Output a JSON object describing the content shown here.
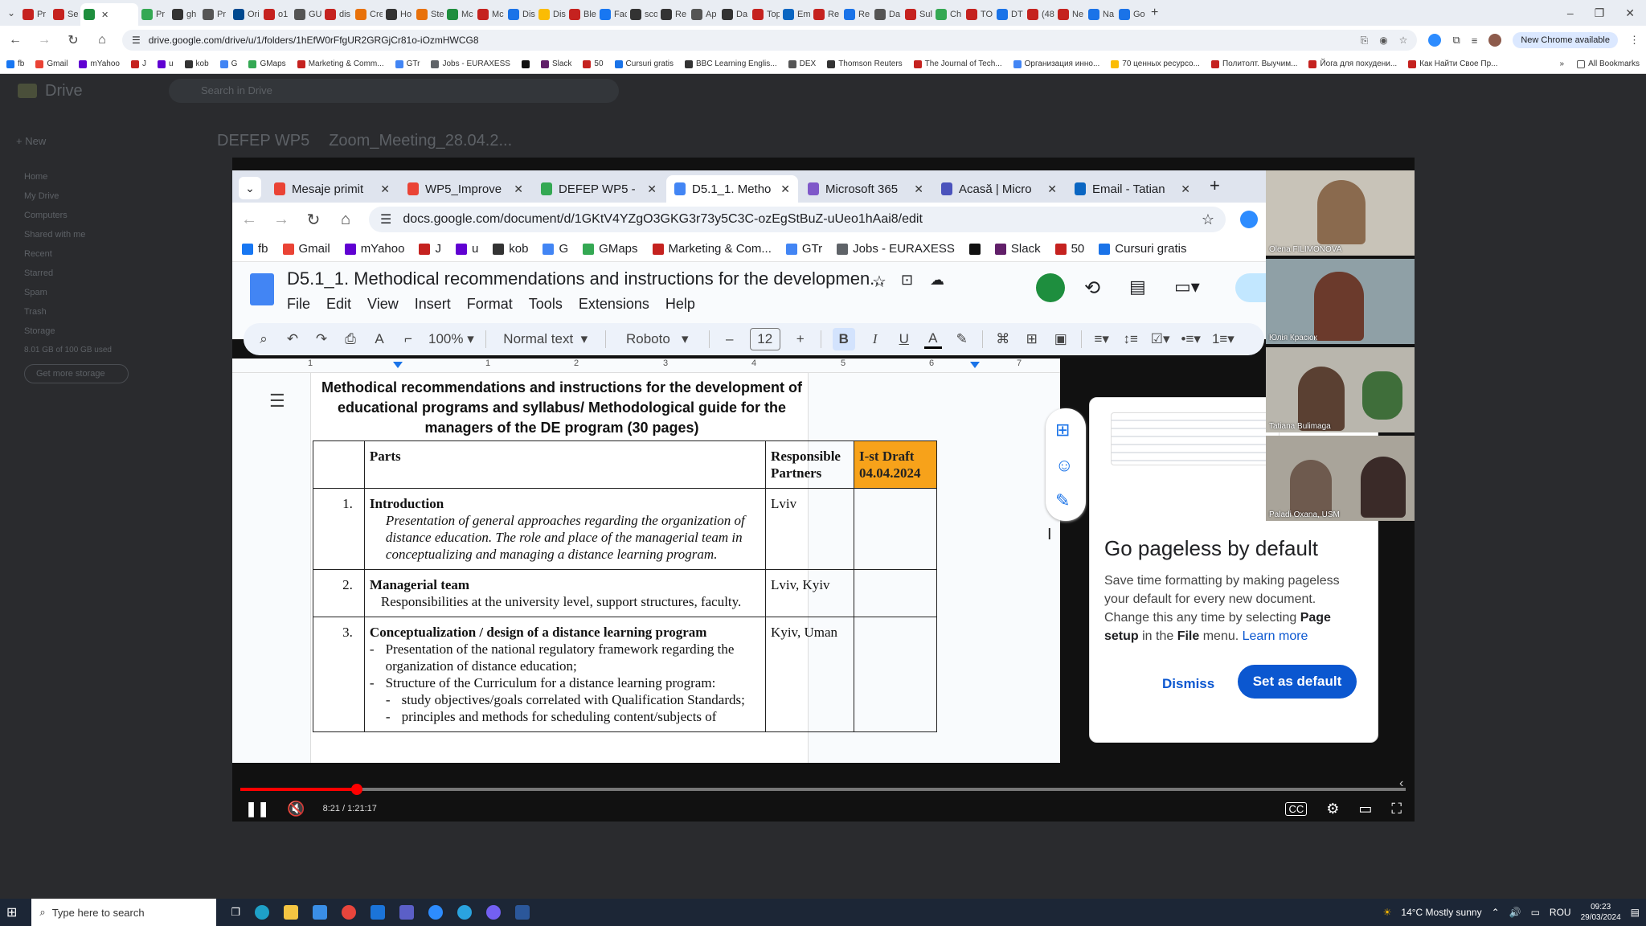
{
  "outer_browser": {
    "tabs": [
      {
        "label": "Pr",
        "color": "#c5221f"
      },
      {
        "label": "Se",
        "color": "#c5221f"
      },
      {
        "label": "",
        "color": "#1e8e3e",
        "active": true
      },
      {
        "label": "Pr",
        "color": "#34a853"
      },
      {
        "label": "gh",
        "color": "#333"
      },
      {
        "label": "Pr",
        "color": "#555"
      },
      {
        "label": "Ori",
        "color": "#00498f"
      },
      {
        "label": "o1",
        "color": "#c5221f"
      },
      {
        "label": "GU",
        "color": "#555"
      },
      {
        "label": "dis",
        "color": "#c5221f"
      },
      {
        "label": "Cre",
        "color": "#e8710a"
      },
      {
        "label": "Ho",
        "color": "#333"
      },
      {
        "label": "Ste",
        "color": "#e8710a"
      },
      {
        "label": "Mc",
        "color": "#1e8e3e"
      },
      {
        "label": "Mc",
        "color": "#c5221f"
      },
      {
        "label": "Dis",
        "color": "#1a73e8"
      },
      {
        "label": "Dis",
        "color": "#fbbc04"
      },
      {
        "label": "Ble",
        "color": "#c5221f"
      },
      {
        "label": "Fac",
        "color": "#1877f2"
      },
      {
        "label": "sco",
        "color": "#333"
      },
      {
        "label": "Re",
        "color": "#333"
      },
      {
        "label": "Ap",
        "color": "#555"
      },
      {
        "label": "Da",
        "color": "#333"
      },
      {
        "label": "Top",
        "color": "#c5221f"
      },
      {
        "label": "Em",
        "color": "#0a66c2"
      },
      {
        "label": "Re",
        "color": "#c5221f"
      },
      {
        "label": "Re",
        "color": "#1a73e8"
      },
      {
        "label": "Da",
        "color": "#555"
      },
      {
        "label": "Sul",
        "color": "#c5221f"
      },
      {
        "label": "Ch",
        "color": "#34a853"
      },
      {
        "label": "TO",
        "color": "#c5221f"
      },
      {
        "label": "DT",
        "color": "#1a73e8"
      },
      {
        "label": "(48",
        "color": "#c5221f"
      },
      {
        "label": "Ne",
        "color": "#c5221f"
      },
      {
        "label": "Na",
        "color": "#1a73e8"
      },
      {
        "label": "Go",
        "color": "#1a73e8"
      }
    ],
    "url": "drive.google.com/drive/u/1/folders/1hEfW0rFfgUR2GRGjCr81o-iOzmHWCG8",
    "new_chrome_pill": "New Chrome available",
    "bookmarks": [
      {
        "label": "fb",
        "color": "#1877f2"
      },
      {
        "label": "Gmail",
        "color": "#ea4335"
      },
      {
        "label": "mYahoo",
        "color": "#6001d2"
      },
      {
        "label": "J",
        "color": "#c5221f"
      },
      {
        "label": "u",
        "color": "#6001d2"
      },
      {
        "label": "kob",
        "color": "#333"
      },
      {
        "label": "G",
        "color": "#4285f4"
      },
      {
        "label": "GMaps",
        "color": "#34a853"
      },
      {
        "label": "Marketing & Comm...",
        "color": "#c5221f"
      },
      {
        "label": "GTr",
        "color": "#4285f4"
      },
      {
        "label": "Jobs - EURAXESS",
        "color": "#5f6368"
      },
      {
        "label": "",
        "color": "#111"
      },
      {
        "label": "Slack",
        "color": "#611f69"
      },
      {
        "label": "50",
        "color": "#c5221f"
      },
      {
        "label": "Cursuri gratis",
        "color": "#1a73e8"
      },
      {
        "label": "BBC Learning Englis...",
        "color": "#333"
      },
      {
        "label": "DEX",
        "color": "#555"
      },
      {
        "label": "Thomson Reuters",
        "color": "#333"
      },
      {
        "label": "The Journal of Tech...",
        "color": "#c5221f"
      },
      {
        "label": "Организация инно...",
        "color": "#4285f4"
      },
      {
        "label": "70 ценных ресурсо...",
        "color": "#fbbc04"
      },
      {
        "label": "Политолт. Выучим...",
        "color": "#c5221f"
      },
      {
        "label": "Йога для похудени...",
        "color": "#c5221f"
      },
      {
        "label": "Как Найти Свое Пр...",
        "color": "#c5221f"
      }
    ],
    "all_bookmarks": "All Bookmarks"
  },
  "drive": {
    "brand": "Drive",
    "search_placeholder": "Search in Drive",
    "new_label": "New",
    "breadcrumb": [
      "DEFEP WP5",
      "Zoom_Meeting_28.04.2..."
    ],
    "sidebar": [
      "Home",
      "My Drive",
      "Computers",
      "Shared with me",
      "Recent",
      "Starred",
      "Spam",
      "Trash",
      "Storage"
    ],
    "storage_text": "8.01 GB of 100 GB used",
    "storage_button": "Get more storage"
  },
  "inner_browser": {
    "tabs": [
      {
        "label": "Mesaje primit",
        "color": "#ea4335"
      },
      {
        "label": "WP5_Improve",
        "color": "#ea4335"
      },
      {
        "label": "DEFEP WP5 -",
        "color": "#34a853"
      },
      {
        "label": "D5.1_1. Metho",
        "color": "#4285f4",
        "active": true
      },
      {
        "label": "Microsoft 365",
        "color": "#7f58c9"
      },
      {
        "label": "Acasă | Micro",
        "color": "#4b53bc"
      },
      {
        "label": "Email - Tatian",
        "color": "#0a66c2"
      }
    ],
    "url": "docs.google.com/document/d/1GKtV4YZgO3GKG3r73y5C3C-ozEgStBuZ-uUeo1hAai8/edit",
    "bookmarks": [
      {
        "label": "fb",
        "color": "#1877f2"
      },
      {
        "label": "Gmail",
        "color": "#ea4335"
      },
      {
        "label": "mYahoo",
        "color": "#6001d2"
      },
      {
        "label": "J",
        "color": "#c5221f"
      },
      {
        "label": "u",
        "color": "#6001d2"
      },
      {
        "label": "kob",
        "color": "#333"
      },
      {
        "label": "G",
        "color": "#4285f4"
      },
      {
        "label": "GMaps",
        "color": "#34a853"
      },
      {
        "label": "Marketing & Com...",
        "color": "#c5221f"
      },
      {
        "label": "GTr",
        "color": "#4285f4"
      },
      {
        "label": "Jobs - EURAXESS",
        "color": "#5f6368"
      },
      {
        "label": "",
        "color": "#111"
      },
      {
        "label": "Slack",
        "color": "#611f69"
      },
      {
        "label": "50",
        "color": "#c5221f"
      },
      {
        "label": "Cursuri gratis",
        "color": "#1a73e8"
      }
    ]
  },
  "docs": {
    "title": "D5.1_1. Methodical recommendations and instructions for the developmen...",
    "menus": [
      "File",
      "Edit",
      "View",
      "Insert",
      "Format",
      "Tools",
      "Extensions",
      "Help"
    ],
    "zoom": "100%",
    "style": "Normal text",
    "font": "Roboto",
    "font_size": "12",
    "ruler_numbers": [
      "1",
      "1",
      "2",
      "3",
      "4",
      "5",
      "6",
      "7"
    ],
    "heading": "Methodical recommendations and instructions for the development of educational programs and syllabus/ Methodological guide for the managers of the DE program (30 pages)",
    "table_header": {
      "parts": "Parts",
      "responsible": "Responsible Partners",
      "draft": "I-st Draft 04.04.2024"
    },
    "rows": [
      {
        "num": "1.",
        "title": "Introduction",
        "italic": "Presentation of general approaches regarding the organization of distance education. The role and place of the managerial team in conceptualizing and managing a distance learning program.",
        "partners": "Lviv"
      },
      {
        "num": "2.",
        "title": "Managerial team",
        "plain": "Responsibilities at the university level, support structures, faculty.",
        "partners": "Lviv, Kyiv"
      },
      {
        "num": "3.",
        "title": "Conceptualization / design of a distance learning program",
        "bullets": [
          "Presentation of the national regulatory framework regarding the organization of distance education;",
          "Structure of the Curriculum for a distance learning program:"
        ],
        "subbullets": [
          "study objectives/goals correlated with Qualification Standards;",
          "principles and methods for scheduling content/subjects of"
        ],
        "partners": "Kyiv, Uman"
      }
    ],
    "pageless": {
      "title": "Go pageless by default",
      "body_1": "Save time formatting by making pageless your default for every new document. Change this any time by selecting ",
      "body_bold_1": "Page setup",
      "body_2": " in the ",
      "body_bold_2": "File",
      "body_3": " menu. ",
      "learn_more": "Learn more",
      "dismiss": "Dismiss",
      "set_default": "Set as default"
    }
  },
  "participants": [
    {
      "name": "Olena FILIMONOVA"
    },
    {
      "name": "Юлія Красюк"
    },
    {
      "name": "Tatiana Bulimaga"
    },
    {
      "name": "Paladi Oxana, USM"
    }
  ],
  "video": {
    "time": "8:21 / 1:21:17",
    "progress_fraction": 0.1
  },
  "taskbar": {
    "search_placeholder": "Type here to search",
    "weather": "14°C  Mostly sunny",
    "lang": "ROU",
    "time": "09:23",
    "date": "29/03/2024"
  }
}
